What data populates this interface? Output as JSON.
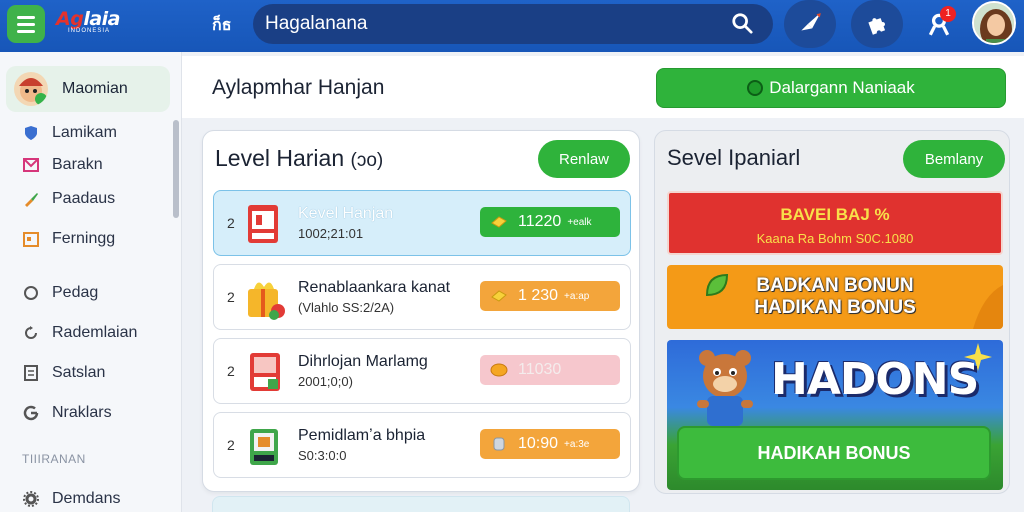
{
  "topbar": {
    "logo_text_red": "Ag",
    "logo_text_white": "laia",
    "logo_sub": "INDONESIA",
    "nav_glyph": "ก็ธ",
    "search_text": "Hagalanana",
    "notif_count": "1"
  },
  "sidebar": {
    "active_label": "Maomian",
    "items": [
      {
        "label": "Lamikam",
        "icon": "shield-icon",
        "color": "#3a6fd0"
      },
      {
        "label": "Barakn",
        "icon": "mail-icon",
        "color": "#d6367a"
      },
      {
        "label": "Paadaus",
        "icon": "puzzle-icon",
        "color": "#e58c2a"
      },
      {
        "label": "Ferningg",
        "icon": "calendar-icon",
        "color": "#e58c2a"
      },
      {
        "label": "Pedag",
        "icon": "chat-icon",
        "color": "#555"
      },
      {
        "label": "Rademlaian",
        "icon": "refresh-icon",
        "color": "#555"
      },
      {
        "label": "Satslan",
        "icon": "document-icon",
        "color": "#555"
      },
      {
        "label": "Nraklars",
        "icon": "google-icon",
        "color": "#555"
      }
    ],
    "section_label": "TIIIRANAN",
    "bottom_item": {
      "label": "Demdans",
      "icon": "gear-icon"
    }
  },
  "header": {
    "title": "Aylapmhar Hanjan",
    "cta_label": "Dalargann Naniaak"
  },
  "left_panel": {
    "title": "Level Harian",
    "title_suffix": "(ɔo)",
    "button_label": "Renlaw",
    "rows": [
      {
        "num": "2",
        "title": "Kevel Hanjan",
        "subtitle": "1002;21:01",
        "value": "11220",
        "sub": "+ealk",
        "style": "green",
        "highlight": true
      },
      {
        "num": "2",
        "title": "Renablaankara kanat",
        "subtitle": "(Vlahlo SS:2/2A)",
        "value": "1 230",
        "sub": "+a:ap",
        "style": "orange",
        "highlight": false
      },
      {
        "num": "2",
        "title": "Dihrlojan Marlamg",
        "subtitle": "2001;0;0)",
        "value": "11030",
        "sub": "",
        "style": "pink",
        "highlight": false
      },
      {
        "num": "2",
        "title": "Pemidlamʼa bhpia",
        "subtitle": "S0:3:0:0",
        "value": "10:90",
        "sub": "+a:3e",
        "style": "orange",
        "highlight": false
      }
    ]
  },
  "right_panel": {
    "title": "Sevel Ipaniarl",
    "button_label": "Bemlany",
    "promo1": {
      "line1": "BAVEI BAJ %",
      "line2": "Kaana Ra Bohm S0C.1080"
    },
    "promo2": {
      "line1": "BADKAN BONUN",
      "line2": "HADIKAN BONUS"
    },
    "promo3": {
      "headline": "HADONS",
      "button_label": "HADIKAH BONUS"
    }
  },
  "colors": {
    "topbar": "#1f62c8",
    "accent_green": "#2fb33b",
    "orange": "#f3a53b",
    "red": "#e0322f"
  }
}
